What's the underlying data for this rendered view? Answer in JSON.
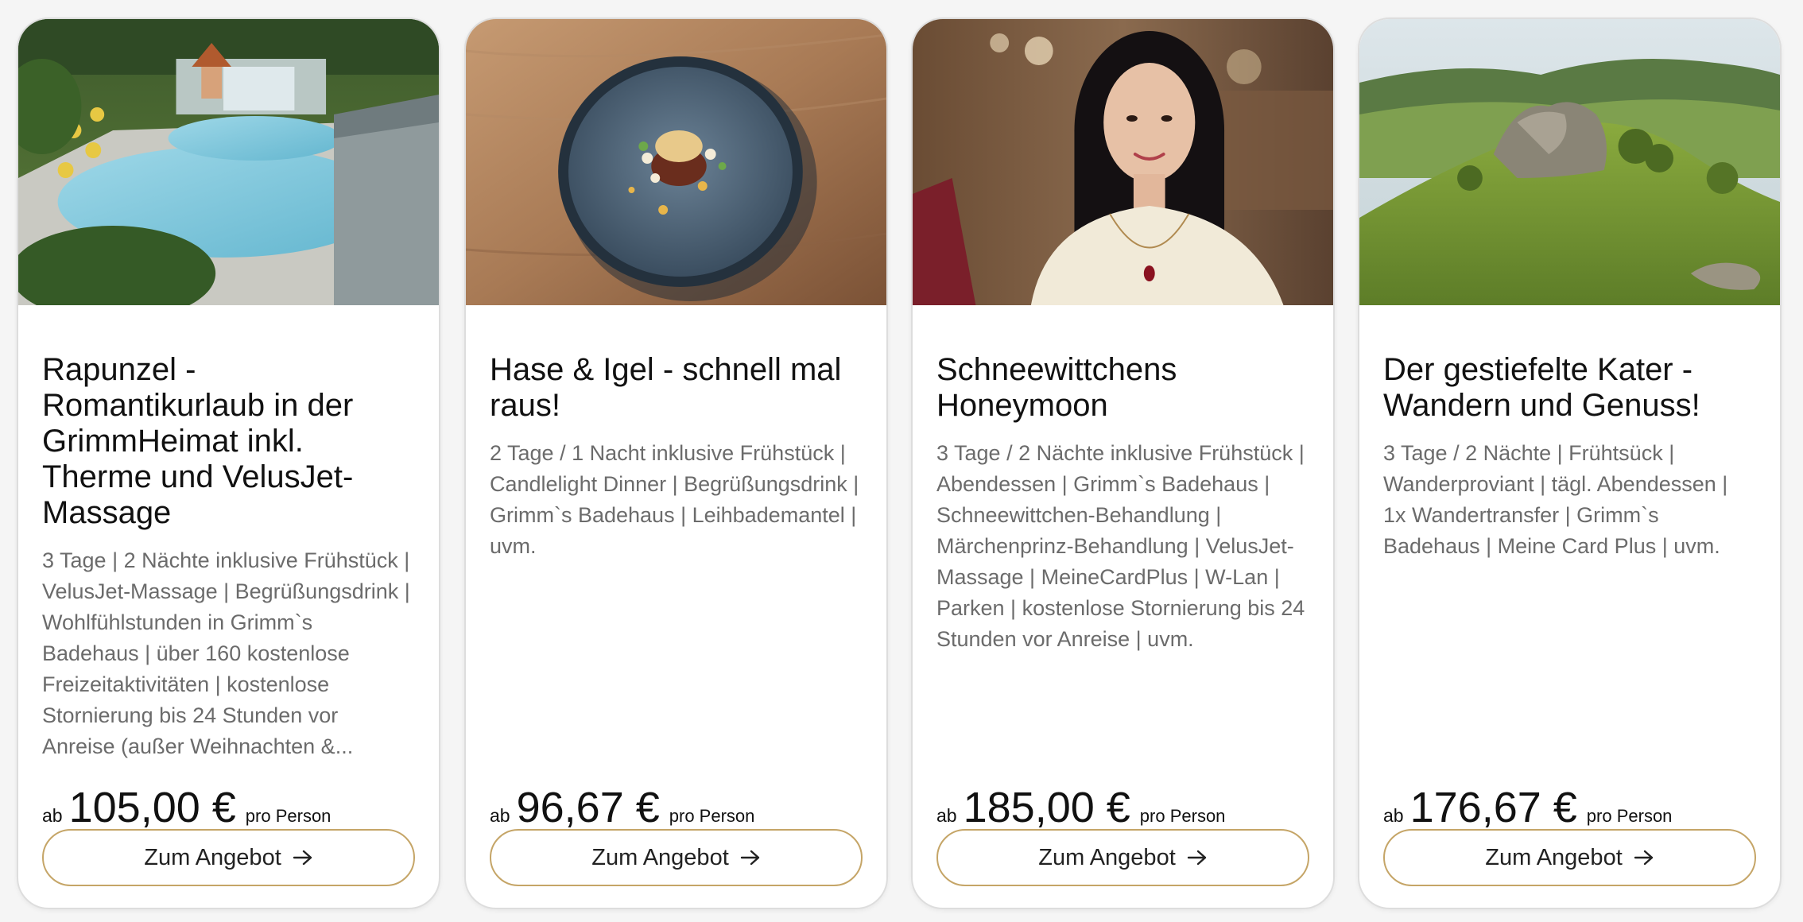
{
  "offers": [
    {
      "title": "Rapunzel - Romantikurlaub in der GrimmHeimat inkl. Therme und VelusJet-Massage",
      "description": "3 Tage | 2 Nächte inklusive Frühstück | VelusJet-Massage | Begrüßungsdrink | Wohlfühlstunden in Grimm`s Badehaus | über 160 kostenlose Freizeitaktivitäten | kostenlose Stornierung bis 24 Stunden vor Anreise (außer Weihnachten &...",
      "price_prefix": "ab",
      "price": "105,00 €",
      "price_suffix": "pro Person",
      "button_label": "Zum Angebot",
      "button_icon": "arrow-right-icon",
      "image": "thermal-pool-resort-photo"
    },
    {
      "title": "Hase & Igel - schnell mal raus!",
      "description": "2 Tage / 1 Nacht inklusive Frühstück | Candlelight Dinner | Begrüßungsdrink | Grimm`s Badehaus | Leihbademantel | uvm.",
      "price_prefix": "ab",
      "price": "96,67 €",
      "price_suffix": "pro Person",
      "button_label": "Zum Angebot",
      "button_icon": "arrow-right-icon",
      "image": "gourmet-plate-photo"
    },
    {
      "title": "Schneewittchens Honeymoon",
      "description": "3 Tage / 2 Nächte inklusive Frühstück | Abendessen | Grimm`s Badehaus | Schneewittchen-Behandlung | Märchenprinz-Behandlung | VelusJet-Massage | MeineCardPlus | W-Lan | Parken | kostenlose Stornierung bis 24 Stunden vor Anreise | uvm.",
      "price_prefix": "ab",
      "price": "185,00 €",
      "price_suffix": "pro Person",
      "button_label": "Zum Angebot",
      "button_icon": "arrow-right-icon",
      "image": "snow-white-portrait-photo"
    },
    {
      "title": "Der gestiefelte Kater - Wandern und Genuss!",
      "description": "3 Tage / 2 Nächte | Frühtsück | Wanderproviant | tägl. Abendessen | 1x Wandertransfer | Grimm`s Badehaus | Meine Card Plus | uvm.",
      "price_prefix": "ab",
      "price": "176,67 €",
      "price_suffix": "pro Person",
      "button_label": "Zum Angebot",
      "button_icon": "arrow-right-icon",
      "image": "hill-landscape-photo"
    }
  ],
  "colors": {
    "button_border": "#c5a567",
    "card_border": "#dddddd",
    "description_text": "#6b6b6b",
    "page_background": "#f5f5f5"
  }
}
